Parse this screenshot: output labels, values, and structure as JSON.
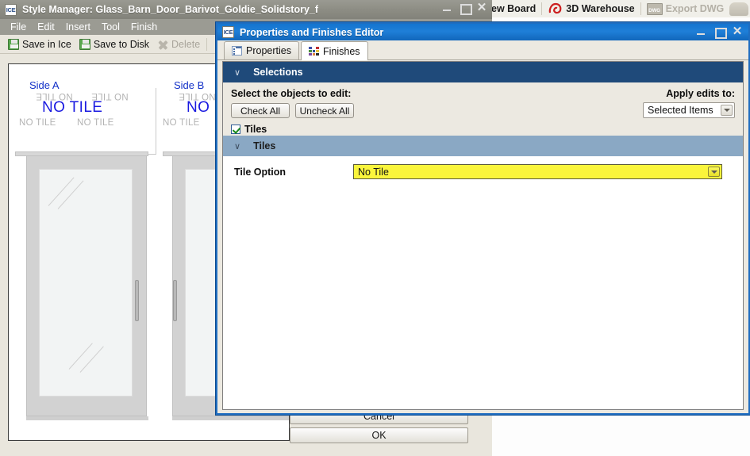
{
  "host_toolbar": {
    "items": [
      {
        "label": "ew Board",
        "icon": "board-icon",
        "disabled": false
      },
      {
        "label": "3D Warehouse",
        "icon": "warehouse-icon",
        "disabled": false
      },
      {
        "label": "Export DWG",
        "icon": "dwg-icon",
        "disabled": true
      }
    ]
  },
  "style_manager": {
    "app_badge": "ICE",
    "title": "Style Manager: Glass_Barn_Door_Barivot_Goldie_Solidstory_f",
    "window_buttons": {
      "minimize": "minimize-button",
      "maximize": "maximize-button",
      "close": "close-button"
    },
    "menu": [
      "File",
      "Edit",
      "Insert",
      "Tool",
      "Finish"
    ],
    "toolbar": [
      {
        "label": "Save in Ice",
        "icon": "save-icon",
        "disabled": false
      },
      {
        "label": "Save to Disk",
        "icon": "save-disk-icon",
        "disabled": false
      },
      {
        "label": "Delete",
        "icon": "delete-x-icon",
        "disabled": true
      },
      {
        "label": "",
        "icon": "text-annotate-icon",
        "disabled": false
      }
    ],
    "preview": {
      "sides": [
        {
          "label": "Side A",
          "big_text": "NO TILE",
          "small_texts": [
            "NO TILE",
            "NO TILE",
            "NO TILE",
            "NO TILE"
          ]
        },
        {
          "label": "Side B",
          "big_text": "NO",
          "small_texts": [
            "NO TILE",
            "NO TILE"
          ]
        }
      ]
    },
    "buttons": {
      "cancel": "Cancel",
      "ok": "OK"
    }
  },
  "dialog": {
    "app_badge": "ICE",
    "title": "Properties and Finishes Editor",
    "window_buttons": {
      "minimize": "minimize-button",
      "maximize": "maximize-button",
      "close": "close-button"
    },
    "tabs": [
      {
        "label": "Properties",
        "icon": "list-icon",
        "active": false
      },
      {
        "label": "Finishes",
        "icon": "color-swatch-icon",
        "active": true
      }
    ],
    "selections": {
      "header": "Selections",
      "prompt": "Select the objects to edit:",
      "check_all": "Check All",
      "uncheck_all": "Uncheck All",
      "apply_label": "Apply edits to:",
      "apply_value": "Selected Items",
      "checkbox_label": "Tiles",
      "checkbox_checked": true
    },
    "tiles": {
      "header": "Tiles",
      "option_label": "Tile Option",
      "option_value": "No Tile"
    }
  },
  "colors": {
    "dialog_accent": "#1f6dc0",
    "section_navy": "#1f4a7a",
    "section_steel": "#8aa8c4",
    "highlight_yellow": "#faf53c",
    "label_blue": "#1230c8"
  }
}
